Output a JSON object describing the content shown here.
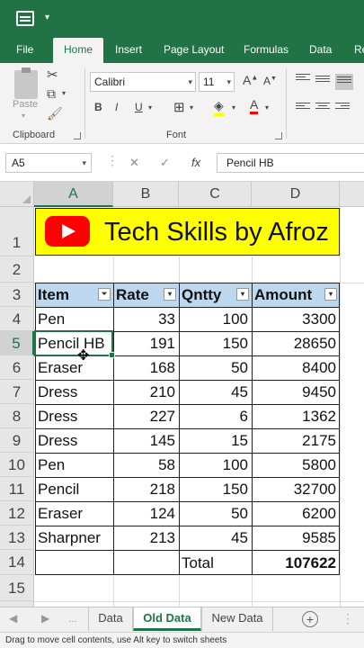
{
  "ribbon_tabs": [
    "File",
    "Home",
    "Insert",
    "Page Layout",
    "Formulas",
    "Data",
    "Re"
  ],
  "clipboard": {
    "paste": "Paste",
    "caret": "▾",
    "group": "Clipboard"
  },
  "font": {
    "name": "Calibri",
    "size": "11",
    "bold": "B",
    "italic": "I",
    "underline": "U",
    "group": "Font"
  },
  "formula_bar": {
    "name_box": "A5",
    "cancel": "✕",
    "enter": "✓",
    "fx": "fx",
    "value": "Pencil HB"
  },
  "columns": [
    "A",
    "B",
    "C",
    "D"
  ],
  "rows": [
    "1",
    "2",
    "3",
    "4",
    "5",
    "6",
    "7",
    "8",
    "9",
    "10",
    "11",
    "12",
    "13",
    "14",
    "15"
  ],
  "banner_title": "Tech Skills by Afroz",
  "table": {
    "headers": [
      "Item",
      "Rate",
      "Qntty",
      "Amount"
    ],
    "rows": [
      [
        "Pen",
        "33",
        "100",
        "3300"
      ],
      [
        "Pencil HB",
        "191",
        "150",
        "28650"
      ],
      [
        "Eraser",
        "168",
        "50",
        "8400"
      ],
      [
        "Dress",
        "210",
        "45",
        "9450"
      ],
      [
        "Dress",
        "227",
        "6",
        "1362"
      ],
      [
        "Dress",
        "145",
        "15",
        "2175"
      ],
      [
        "Pen",
        "58",
        "100",
        "5800"
      ],
      [
        "Pencil",
        "218",
        "150",
        "32700"
      ],
      [
        "Eraser",
        "124",
        "50",
        "6200"
      ],
      [
        "Sharpner",
        "213",
        "45",
        "9585"
      ]
    ],
    "total_label": "Total",
    "total_value": "107622"
  },
  "sheet_tabs": [
    "Data",
    "Old Data",
    "New Data"
  ],
  "active_sheet": "Old Data",
  "add_sheet": "+",
  "status_text": "Drag to move cell contents, use Alt key to switch sheets",
  "colors": {
    "excel_green": "#217346",
    "header_fill": "#bdd7ee",
    "banner_fill": "#ffff00",
    "youtube_red": "#ff0000"
  }
}
